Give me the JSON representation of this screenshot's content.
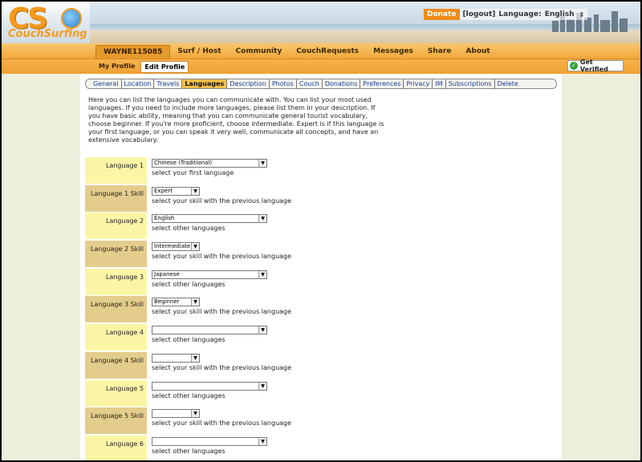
{
  "logo": {
    "cs": "CS",
    "word": "CouchSurfing"
  },
  "top": {
    "donate": "Donate",
    "logout": "[logout]",
    "language_label": "Language:",
    "language_value": "English"
  },
  "nav": {
    "items": [
      {
        "label": "WAYNE115085"
      },
      {
        "label": "Surf / Host"
      },
      {
        "label": "Community"
      },
      {
        "label": "CouchRequests"
      },
      {
        "label": "Messages"
      },
      {
        "label": "Share"
      },
      {
        "label": "About"
      }
    ]
  },
  "subnav": {
    "items": [
      {
        "label": "My Profile"
      },
      {
        "label": "Edit Profile"
      }
    ],
    "verified": "Get Verified"
  },
  "tabs": [
    "General",
    "Location",
    "Travels",
    "Languages",
    "Description",
    "Photos",
    "Couch",
    "Donations",
    "Preferences",
    "Privacy",
    "IM",
    "Subscriptions",
    "Delete"
  ],
  "intro": "Here you can list the languages you can communicate with. You can list your most used languages. If you need to include more languages, please list them in your description. If you have basic ability, meaning that you can communicate general tourist vocabulary, choose beginner. If you're more proficient, choose intermediate. Expert is if this language is your first language, or you can speak it very well, communicate all concepts, and have an extensive vocabulary.",
  "rows": [
    {
      "label": "Language 1",
      "value": "Chinese (Traditional)",
      "hint": "select your first language"
    },
    {
      "label": "Language 1 Skill",
      "value": "Expert",
      "hint": "select your skill with the previous language"
    },
    {
      "label": "Language 2",
      "value": "English",
      "hint": "select other languages"
    },
    {
      "label": "Language 2 Skill",
      "value": "Intermediate",
      "hint": "select your skill with the previous language"
    },
    {
      "label": "Language 3",
      "value": "Japanese",
      "hint": "select other languages"
    },
    {
      "label": "Language 3 Skill",
      "value": "Beginner",
      "hint": "select your skill with the previous language"
    },
    {
      "label": "Language 4",
      "value": "",
      "hint": "select other languages"
    },
    {
      "label": "Language 4 Skill",
      "value": "",
      "hint": "select your skill with the previous language"
    },
    {
      "label": "Language 5",
      "value": "",
      "hint": "select other languages"
    },
    {
      "label": "Language 5 Skill",
      "value": "",
      "hint": "select your skill with the previous language"
    },
    {
      "label": "Language 6",
      "value": "",
      "hint": "select other languages"
    }
  ]
}
